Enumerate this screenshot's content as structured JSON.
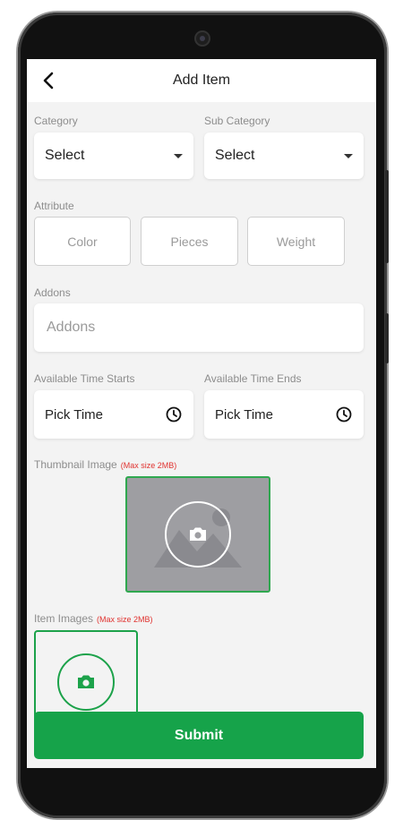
{
  "header": {
    "title": "Add Item"
  },
  "category": {
    "label": "Category",
    "value": "Select"
  },
  "sub_category": {
    "label": "Sub Category",
    "value": "Select"
  },
  "attribute": {
    "label": "Attribute",
    "options": [
      "Color",
      "Pieces",
      "Weight"
    ]
  },
  "addons": {
    "label": "Addons",
    "placeholder": "Addons"
  },
  "time_start": {
    "label": "Available Time Starts",
    "value": "Pick Time"
  },
  "time_end": {
    "label": "Available Time Ends",
    "value": "Pick Time"
  },
  "thumbnail": {
    "label": "Thumbnail Image",
    "note": "(Max size 2MB)"
  },
  "item_images": {
    "label": "Item Images",
    "note": "(Max size 2MB)"
  },
  "submit": {
    "label": "Submit"
  },
  "colors": {
    "primary": "#16a34a",
    "accent_border": "#2fa84f",
    "note_red": "#e0322f"
  }
}
